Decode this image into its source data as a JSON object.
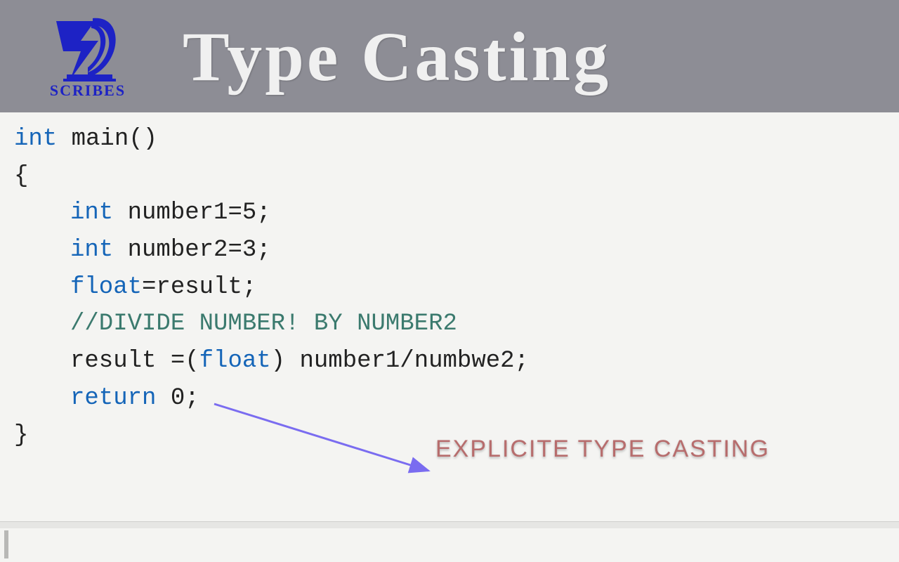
{
  "header": {
    "logo_label": "SCRIBES",
    "title": "Type Casting"
  },
  "code": {
    "line1_kw": "int",
    "line1_rest": " main()",
    "line2": "{",
    "line3_kw": "int",
    "line3_rest": " number1=5;",
    "line4_kw": "int",
    "line4_rest": " number2=3;",
    "line5_kw": "float",
    "line5_rest": "=result;",
    "line6_comment": "//DIVIDE NUMBER! BY NUMBER2",
    "line7_a": "result =(",
    "line7_kw": "float",
    "line7_b": ") number1/numbwe2;",
    "line8_kw": "return",
    "line8_rest": " 0;",
    "line9": "}"
  },
  "annotation": {
    "text": "EXPLICITE TYPE CASTING"
  },
  "colors": {
    "header_bg": "#8d8d95",
    "logo_blue": "#1d22c5",
    "keyword": "#1565b8",
    "comment": "#3b7a6e",
    "annotation": "#b76d6d",
    "arrow": "#7a6cf0"
  }
}
